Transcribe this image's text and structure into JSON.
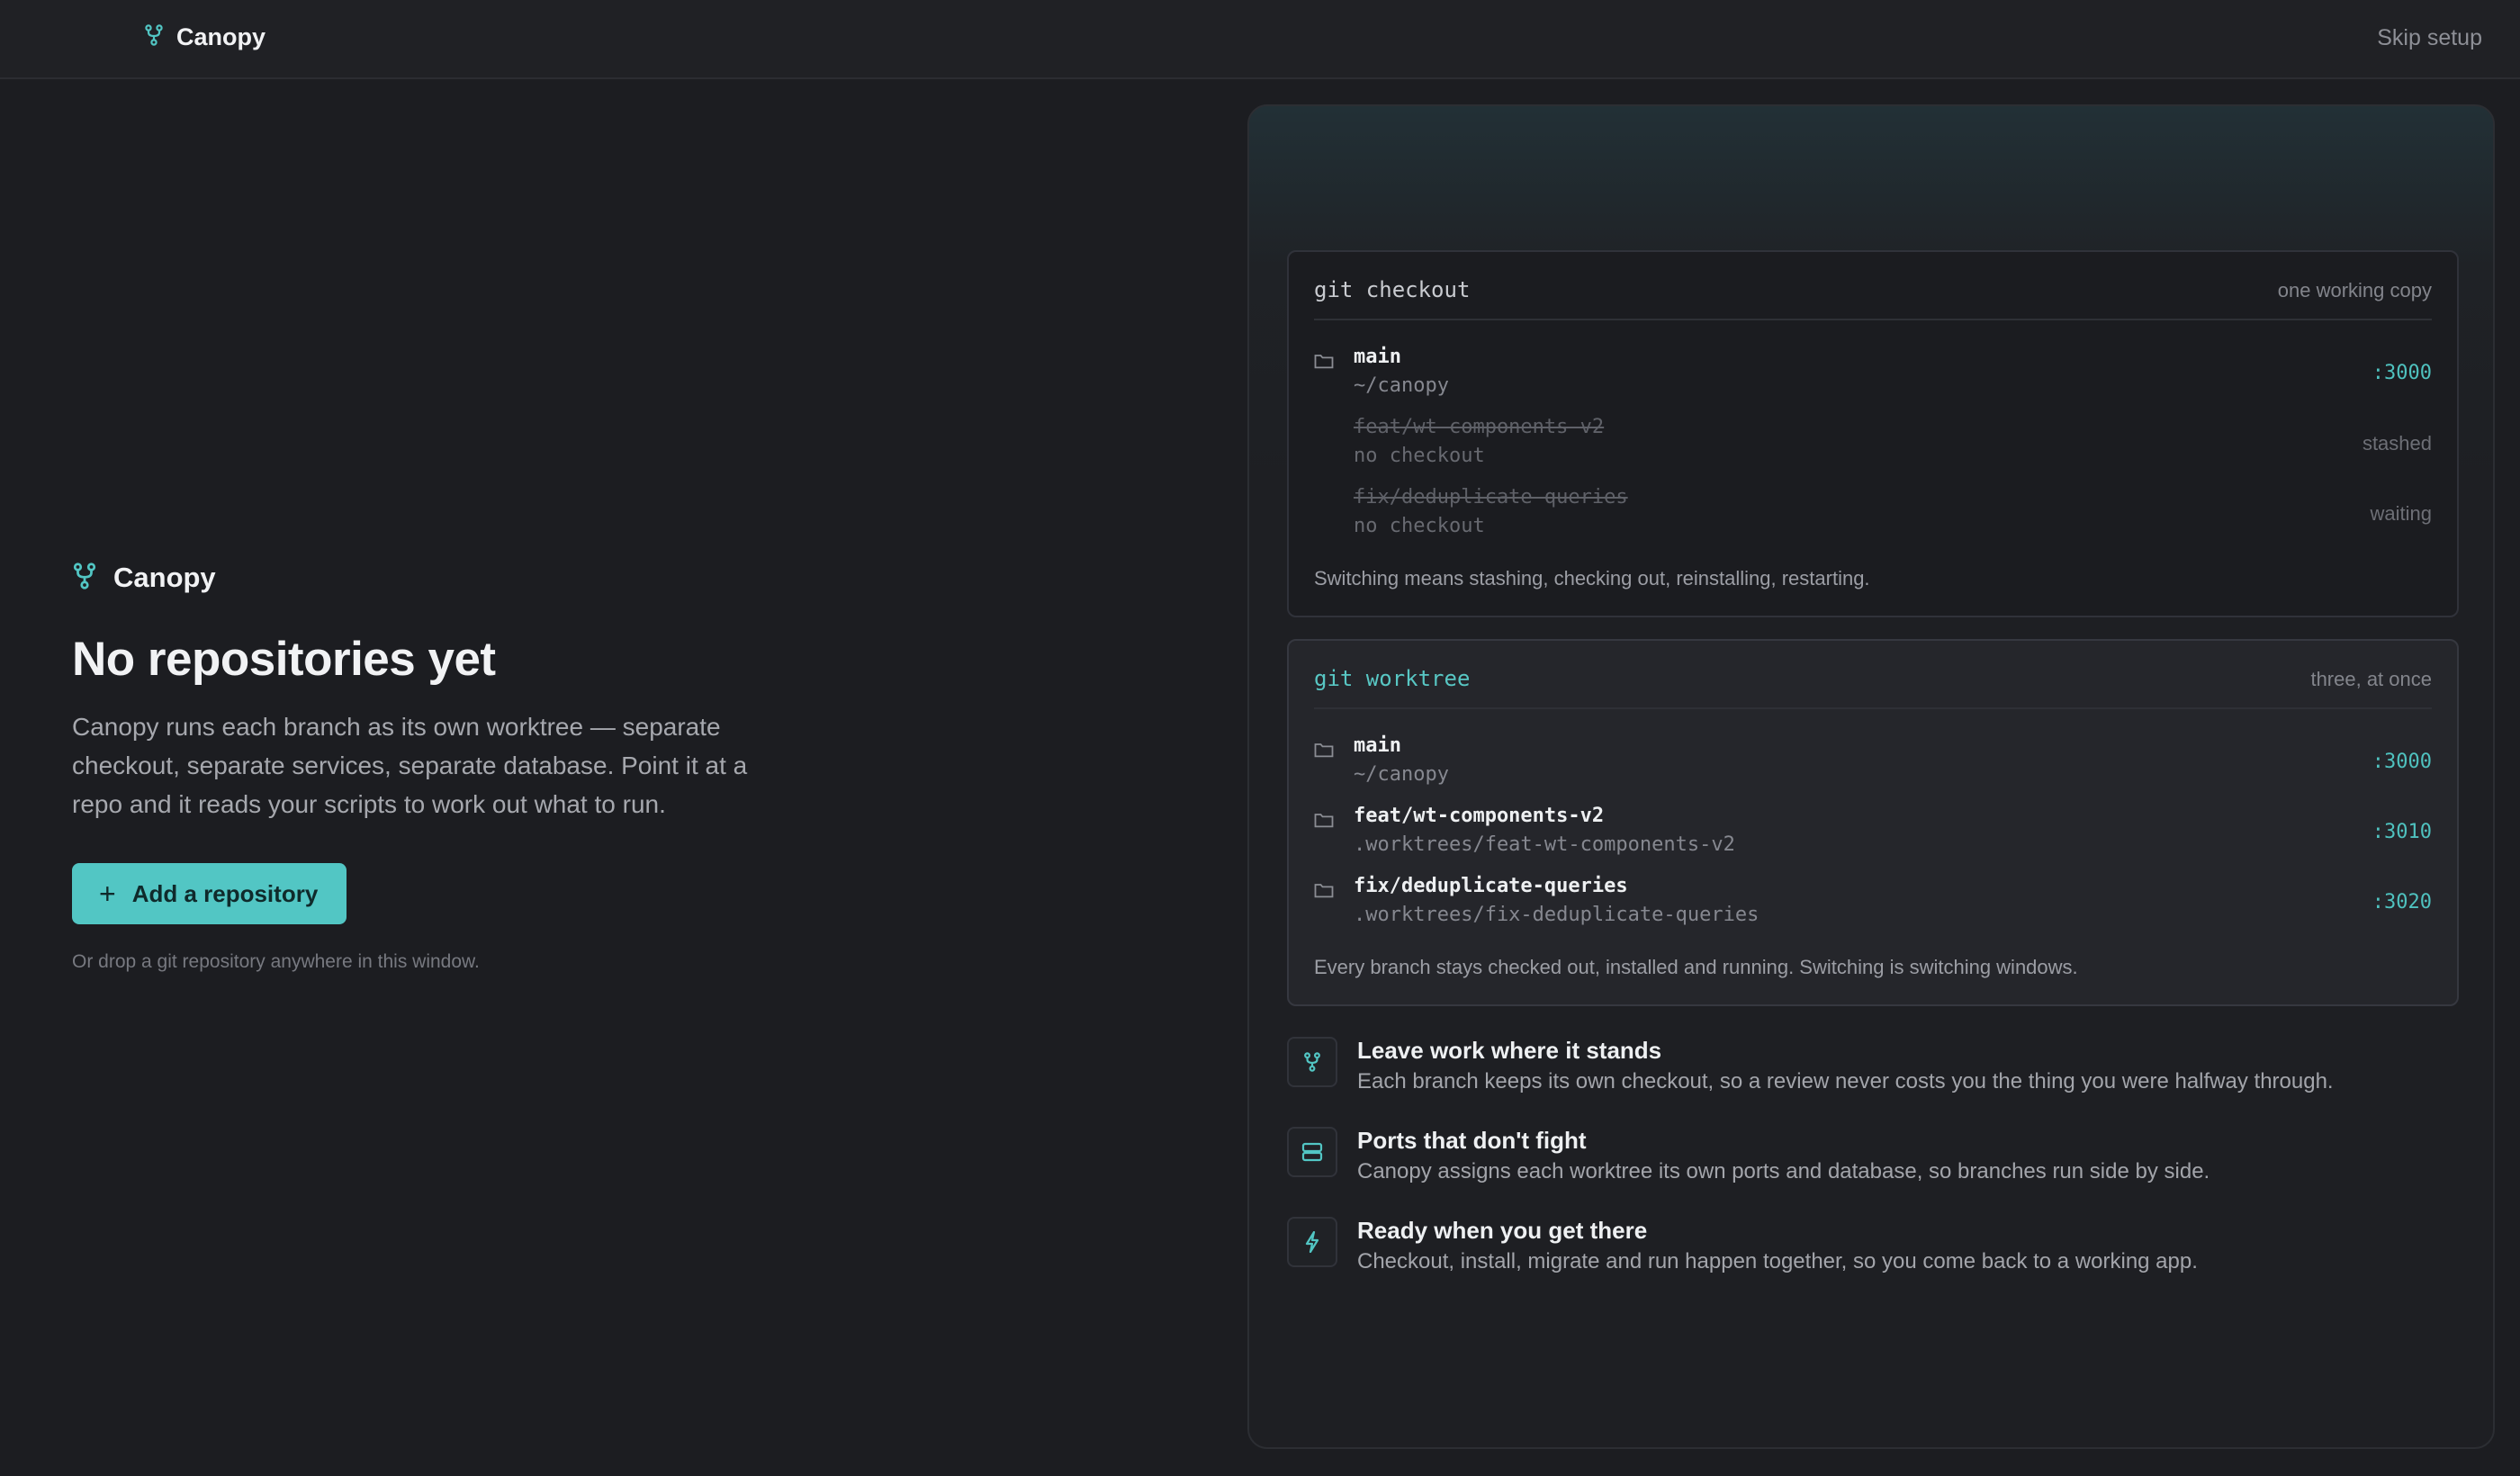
{
  "app": {
    "name": "Canopy"
  },
  "topbar": {
    "skip_label": "Skip setup"
  },
  "intro": {
    "brand_name": "Canopy",
    "title": "No repositories yet",
    "description": "Canopy runs each branch as its own worktree — separate checkout, separate services, separate database. Point it at a repo and it reads your scripts to work out what to run.",
    "add_button_label": "Add a repository",
    "drop_hint": "Or drop a git repository anywhere in this window."
  },
  "checkout_card": {
    "title": "git checkout",
    "meta": "one working copy",
    "rows": [
      {
        "name": "main",
        "path": "~/canopy",
        "status": ":3000"
      },
      {
        "name": "feat/wt-components-v2",
        "path": "no checkout",
        "status": "stashed"
      },
      {
        "name": "fix/deduplicate-queries",
        "path": "no checkout",
        "status": "waiting"
      }
    ],
    "footer": "Switching means stashing, checking out, reinstalling, restarting."
  },
  "worktree_card": {
    "title": "git worktree",
    "meta": "three, at once",
    "rows": [
      {
        "name": "main",
        "path": "~/canopy",
        "status": ":3000"
      },
      {
        "name": "feat/wt-components-v2",
        "path": ".worktrees/feat-wt-components-v2",
        "status": ":3010"
      },
      {
        "name": "fix/deduplicate-queries",
        "path": ".worktrees/fix-deduplicate-queries",
        "status": ":3020"
      }
    ],
    "footer": "Every branch stays checked out, installed and running. Switching is switching windows."
  },
  "features": [
    {
      "icon": "git-branch-icon",
      "title": "Leave work where it stands",
      "description": "Each branch keeps its own checkout, so a review never costs you the thing you were halfway through."
    },
    {
      "icon": "server-icon",
      "title": "Ports that don't fight",
      "description": "Canopy assigns each worktree its own ports and database, so branches run side by side."
    },
    {
      "icon": "lightning-icon",
      "title": "Ready when you get there",
      "description": "Checkout, install, migrate and run happen together, so you come back to a working app."
    }
  ],
  "colors": {
    "accent": "#52c6c4",
    "background": "#1c1d21",
    "panel": "#1e1f23"
  }
}
